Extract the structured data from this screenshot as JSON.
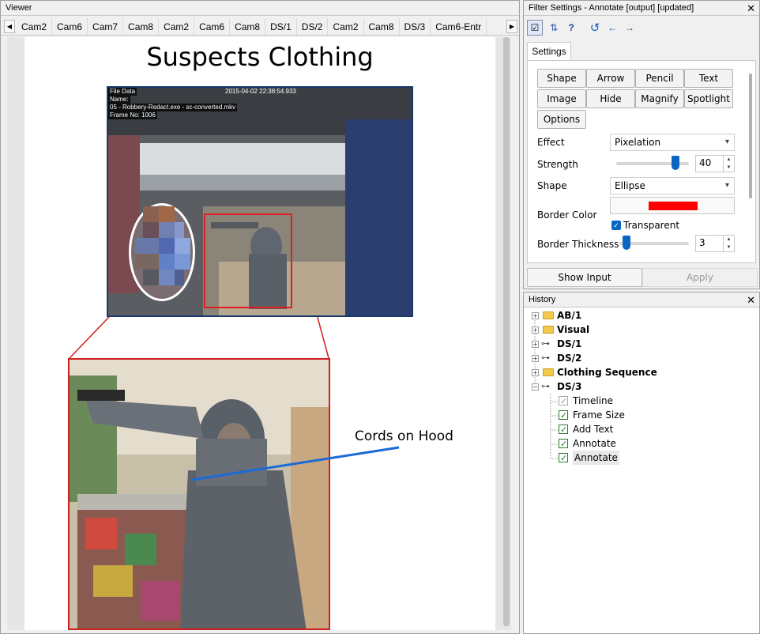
{
  "viewer": {
    "title": "Viewer",
    "tabs": [
      "Cam2",
      "Cam6",
      "Cam7",
      "Cam8",
      "Cam2",
      "Cam6",
      "Cam8",
      "DS/1",
      "DS/2",
      "Cam2",
      "Cam8",
      "DS/3",
      "Cam6-Entr"
    ],
    "document_title": "Suspects Clothing",
    "frame_overlay": {
      "file_data": "File Data",
      "name": "Name:",
      "file": "05 - Robbery-Redact.exe - sc-converted.mkv",
      "frame": "Frame No: 1006",
      "timestamp": "2015-04-02 22:38:54.933"
    },
    "annotation_label": "Cords on Hood"
  },
  "filter_settings": {
    "title": "Filter Settings - Annotate [output] [updated]",
    "tab_label": "Settings",
    "mode_buttons": [
      "Shape",
      "Arrow",
      "Pencil",
      "Text",
      "Image",
      "Hide",
      "Magnify",
      "Spotlight",
      "Options"
    ],
    "effect_label": "Effect",
    "effect_value": "Pixelation",
    "strength_label": "Strength",
    "strength_value": "40",
    "strength_level": 0.85,
    "shape_label": "Shape",
    "shape_value": "Ellipse",
    "border_color_label": "Border Color",
    "border_color": "#ff0000",
    "transparent_label": "Transparent",
    "border_thickness_label": "Border Thickness",
    "border_thickness_value": "3",
    "border_thickness_level": 0.05,
    "show_input_label": "Show Input",
    "apply_label": "Apply"
  },
  "history": {
    "title": "History",
    "items": [
      {
        "label": "AB/1",
        "type": "folder"
      },
      {
        "label": "Visual",
        "type": "folder"
      },
      {
        "label": "DS/1",
        "type": "link"
      },
      {
        "label": "DS/2",
        "type": "link"
      },
      {
        "label": "Clothing Sequence",
        "type": "folder"
      },
      {
        "label": "DS/3",
        "type": "link"
      }
    ],
    "children": [
      {
        "label": "Timeline",
        "checked": "grey"
      },
      {
        "label": "Frame Size",
        "checked": "on"
      },
      {
        "label": "Add Text",
        "checked": "on"
      },
      {
        "label": "Annotate",
        "checked": "on"
      },
      {
        "label": "Annotate",
        "checked": "on"
      }
    ]
  }
}
